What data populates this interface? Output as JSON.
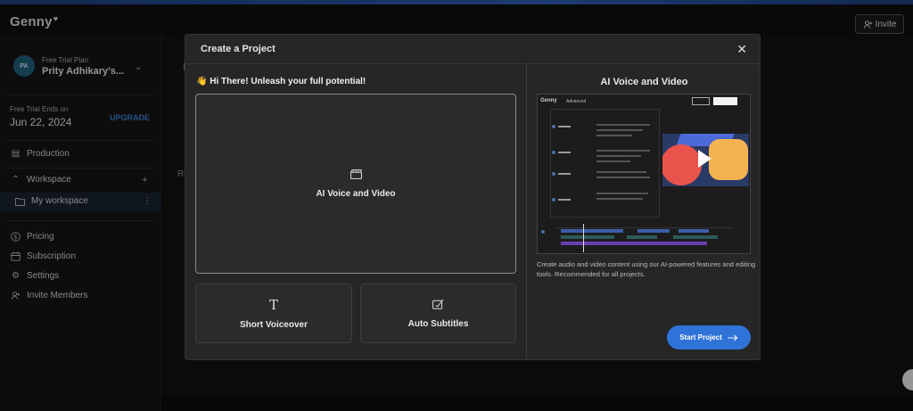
{
  "app": {
    "logo": "Genny",
    "logo_mark": "♥"
  },
  "header": {
    "invite_label": "Invite"
  },
  "sidebar": {
    "plan_label": "Free Trial Plan",
    "user_initials": "PA",
    "user_name": "Prity Adhikary's...",
    "trial_label": "Free Trial Ends on",
    "trial_date": "Jun 22, 2024",
    "upgrade_label": "UPGRADE",
    "production_label": "Production",
    "workspace_label": "Workspace",
    "my_workspace_label": "My workspace",
    "pricing_label": "Pricing",
    "subscription_label": "Subscription",
    "settings_label": "Settings",
    "invite_members_label": "Invite Members"
  },
  "background": {
    "heading_initial": "P",
    "section_initial": "Re"
  },
  "modal": {
    "title": "Create a Project",
    "greeting": "👋 Hi There! Unleash your full potential!",
    "cards": {
      "ai_voice_video": "AI Voice and Video",
      "short_voiceover": "Short Voiceover",
      "auto_subtitles": "Auto Subtitles"
    },
    "preview": {
      "title": "AI Voice and Video",
      "logo": "Genny",
      "mode": "Advanced",
      "description": "Create audio and video content using our AI-powered features and editing tools. Recommended for all projects."
    },
    "start_button": "Start Project"
  },
  "colors": {
    "accent": "#2f73d9",
    "upgrade": "#3a7fd0"
  }
}
